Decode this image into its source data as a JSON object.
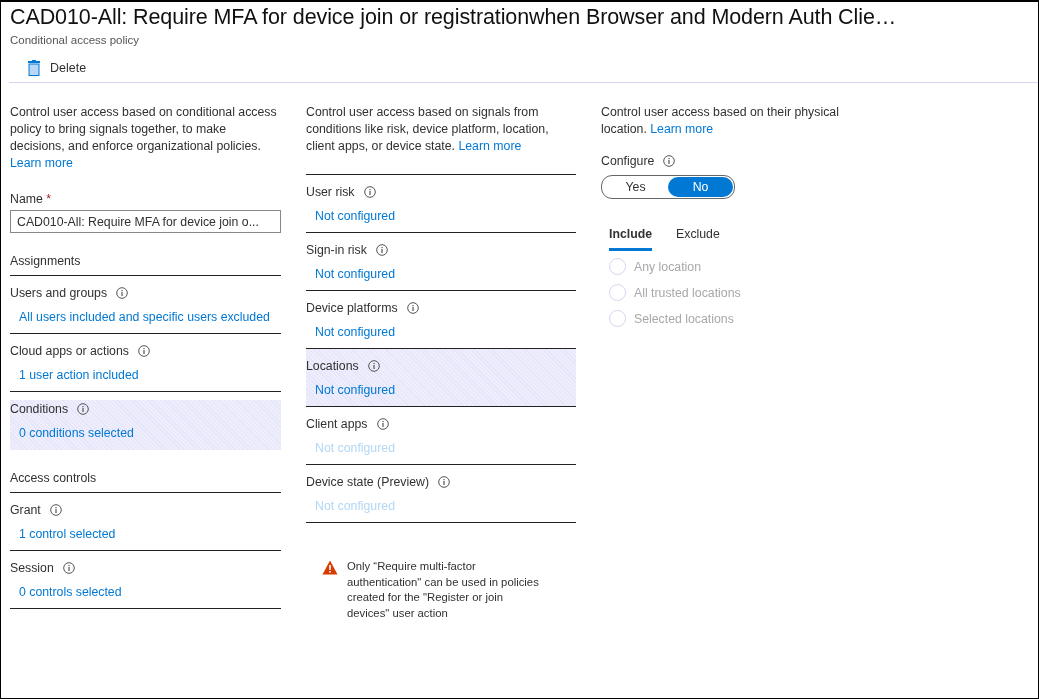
{
  "header": {
    "title": "CAD010-All: Require MFA for device join or registrationwhen Browser and Modern Auth Clie…",
    "subtitle": "Conditional access policy"
  },
  "toolbar": [
    {
      "label": "Delete",
      "kind": "delete"
    }
  ],
  "left": {
    "description": "Control user access based on conditional access policy to bring signals together, to make decisions, and enforce organizational policies.",
    "link": "Learn more",
    "name_label": "Name",
    "required_mark": "*",
    "name_value": "CAD010-All: Require MFA for device join o...",
    "sections": [
      {
        "title": "Assignments",
        "items": [
          {
            "label": "Users and groups",
            "value": "All users included and specific users excluded",
            "selected": false
          },
          {
            "label": "Cloud apps or actions",
            "value": "1 user action included",
            "selected": false
          },
          {
            "label": "Conditions",
            "value": "0 conditions selected",
            "selected": true
          }
        ]
      },
      {
        "title": "Access controls",
        "items": [
          {
            "label": "Grant",
            "value": "1 control selected",
            "selected": false
          },
          {
            "label": "Session",
            "value": "0 controls selected",
            "selected": false
          }
        ]
      }
    ]
  },
  "middle": {
    "description": "Control user access based on signals from conditions like risk, device platform, location, client apps, or device state.",
    "link": "Learn more",
    "items": [
      {
        "label": "User risk",
        "value": "Not configured",
        "selected": false,
        "disabled": false
      },
      {
        "label": "Sign-in risk",
        "value": "Not configured",
        "selected": false,
        "disabled": false
      },
      {
        "label": "Device platforms",
        "value": "Not configured",
        "selected": false,
        "disabled": false
      },
      {
        "label": "Locations",
        "value": "Not configured",
        "selected": true,
        "disabled": false
      },
      {
        "label": "Client apps",
        "value": "Not configured",
        "selected": false,
        "disabled": true
      },
      {
        "label": "Device state (Preview)",
        "value": "Not configured",
        "selected": false,
        "disabled": true
      }
    ],
    "warning": "Only “Require multi-factor authentication\" can be used in policies created for the \"Register or join devices\" user action"
  },
  "right": {
    "description": "Control user access based on their physical location.",
    "link": "Learn more",
    "configure_label": "Configure",
    "toggle": [
      {
        "label": "Yes",
        "selected": false
      },
      {
        "label": "No",
        "selected": true
      }
    ],
    "tabs": [
      {
        "label": "Include",
        "selected": true
      },
      {
        "label": "Exclude",
        "selected": false
      }
    ],
    "options": [
      {
        "label": "Any location",
        "checked": false,
        "disabled": true
      },
      {
        "label": "All trusted locations",
        "checked": false,
        "disabled": true
      },
      {
        "label": "Selected locations",
        "checked": false,
        "disabled": true
      }
    ]
  }
}
